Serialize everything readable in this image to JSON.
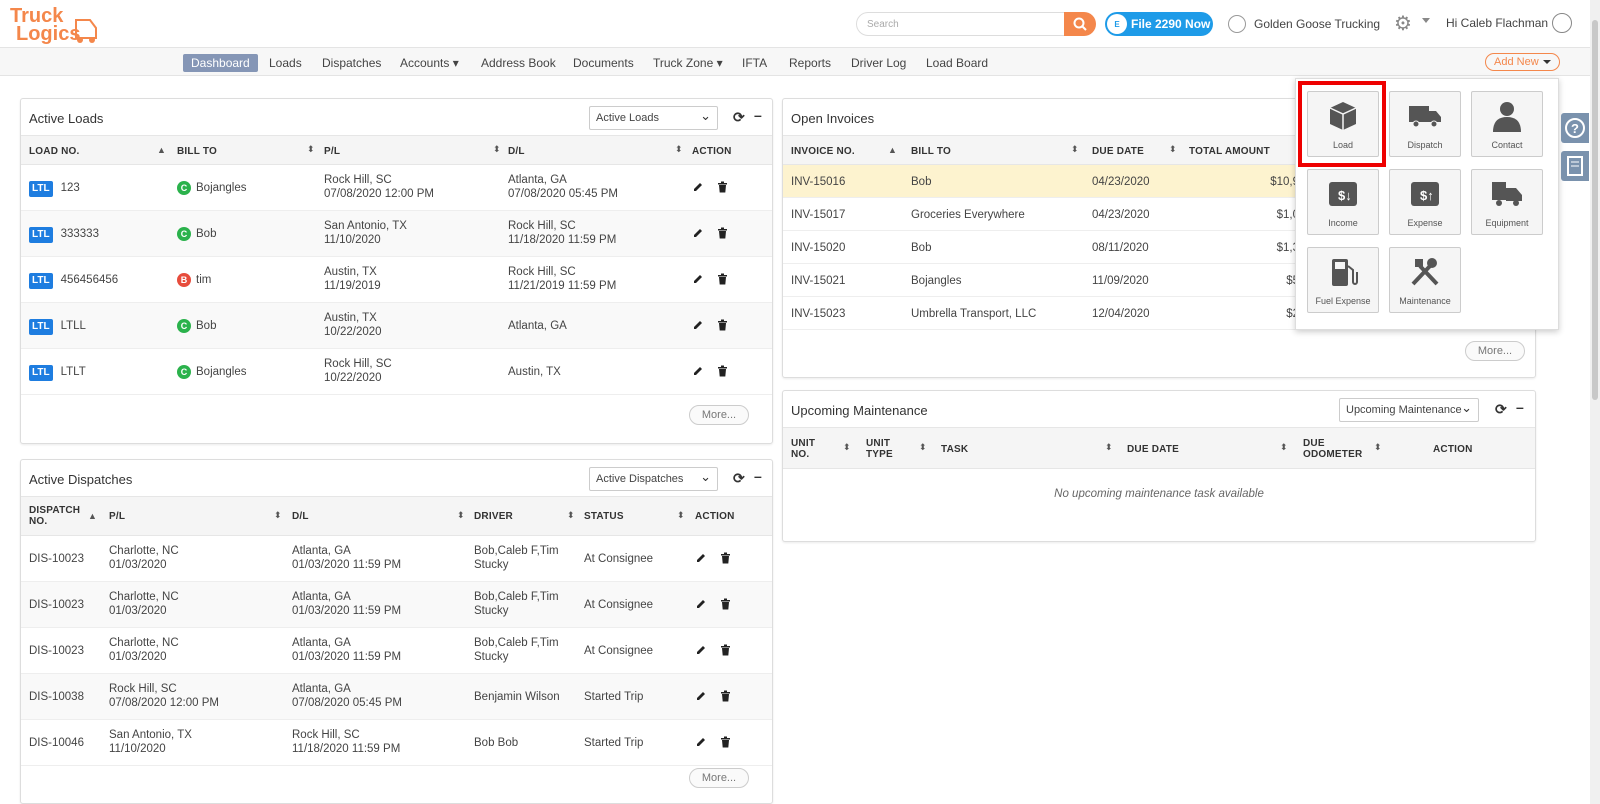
{
  "header": {
    "logo_text": "Truck Logics",
    "search_placeholder": "Search",
    "file_badge": "E",
    "file_label": "File 2290 Now",
    "company": "Golden Goose Trucking",
    "greeting": "Hi Caleb Flachman"
  },
  "nav": {
    "items": [
      "Dashboard",
      "Loads",
      "Dispatches",
      "Accounts ▾",
      "Address Book",
      "Documents",
      "Truck Zone ▾",
      "IFTA",
      "Reports",
      "Driver Log",
      "Load Board"
    ],
    "add_new": "Add New"
  },
  "active_loads": {
    "title": "Active Loads",
    "select": "Active Loads",
    "headers": [
      "LOAD NO.",
      "BILL TO",
      "P/L",
      "D/L",
      "ACTION"
    ],
    "rows": [
      {
        "type": "LTL",
        "no": "123",
        "badge": "C",
        "bill": "Bojangles",
        "pl1": "Rock Hill, SC",
        "pl2": "07/08/2020 12:00 PM",
        "dl1": "Atlanta, GA",
        "dl2": "07/08/2020 05:45 PM"
      },
      {
        "type": "LTL",
        "no": "333333",
        "badge": "C",
        "bill": "Bob",
        "pl1": "San Antonio, TX",
        "pl2": "11/10/2020",
        "dl1": "Rock Hill, SC",
        "dl2": "11/18/2020 11:59 PM"
      },
      {
        "type": "LTL",
        "no": "456456456",
        "badge": "B",
        "bill": "tim",
        "pl1": "Austin, TX",
        "pl2": "11/19/2019",
        "dl1": "Rock Hill, SC",
        "dl2": "11/21/2019 11:59 PM"
      },
      {
        "type": "LTL",
        "no": "LTLL",
        "badge": "C",
        "bill": "Bob",
        "pl1": "Austin, TX",
        "pl2": "10/22/2020",
        "dl1": "Atlanta, GA",
        "dl2": ""
      },
      {
        "type": "LTL",
        "no": "LTLT",
        "badge": "C",
        "bill": "Bojangles",
        "pl1": "Rock Hill, SC",
        "pl2": "10/22/2020",
        "dl1": "Austin, TX",
        "dl2": ""
      }
    ],
    "more": "More..."
  },
  "active_dispatches": {
    "title": "Active Dispatches",
    "select": "Active Dispatches",
    "headers": [
      "DISPATCH NO.",
      "P/L",
      "D/L",
      "DRIVER",
      "STATUS",
      "ACTION"
    ],
    "rows": [
      {
        "no": "DIS-10023",
        "pl1": "Charlotte, NC",
        "pl2": "01/03/2020",
        "dl1": "Atlanta, GA",
        "dl2": "01/03/2020 11:59 PM",
        "drv1": "Bob,Caleb F,Tim",
        "drv2": "Stucky",
        "status": "At Consignee"
      },
      {
        "no": "DIS-10023",
        "pl1": "Charlotte, NC",
        "pl2": "01/03/2020",
        "dl1": "Atlanta, GA",
        "dl2": "01/03/2020 11:59 PM",
        "drv1": "Bob,Caleb F,Tim",
        "drv2": "Stucky",
        "status": "At Consignee"
      },
      {
        "no": "DIS-10023",
        "pl1": "Charlotte, NC",
        "pl2": "01/03/2020",
        "dl1": "Atlanta, GA",
        "dl2": "01/03/2020 11:59 PM",
        "drv1": "Bob,Caleb F,Tim",
        "drv2": "Stucky",
        "status": "At Consignee"
      },
      {
        "no": "DIS-10038",
        "pl1": "Rock Hill, SC",
        "pl2": "07/08/2020 12:00 PM",
        "dl1": "Atlanta, GA",
        "dl2": "07/08/2020 05:45 PM",
        "drv1": "Benjamin Wilson",
        "drv2": "",
        "status": "Started Trip"
      },
      {
        "no": "DIS-10046",
        "pl1": "San Antonio, TX",
        "pl2": "11/10/2020",
        "dl1": "Rock Hill, SC",
        "dl2": "11/18/2020 11:59 PM",
        "drv1": "Bob Bob",
        "drv2": "",
        "status": "Started Trip"
      }
    ],
    "more": "More..."
  },
  "open_invoices": {
    "title": "Open Invoices",
    "headers": [
      "INVOICE NO.",
      "BILL TO",
      "DUE DATE",
      "TOTAL AMOUNT"
    ],
    "rows": [
      {
        "no": "INV-15016",
        "bill": "Bob",
        "due": "04/23/2020",
        "amt": "$10,9"
      },
      {
        "no": "INV-15017",
        "bill": "Groceries Everywhere",
        "due": "04/23/2020",
        "amt": "$1,0"
      },
      {
        "no": "INV-15020",
        "bill": "Bob",
        "due": "08/11/2020",
        "amt": "$1,3"
      },
      {
        "no": "INV-15021",
        "bill": "Bojangles",
        "due": "11/09/2020",
        "amt": "$5"
      },
      {
        "no": "INV-15023",
        "bill": "Umbrella Transport, LLC",
        "due": "12/04/2020",
        "amt": "$2"
      }
    ],
    "more": "More..."
  },
  "maintenance": {
    "title": "Upcoming Maintenance",
    "select": "Upcoming Maintenance",
    "headers": [
      "UNIT NO.",
      "UNIT TYPE",
      "TASK",
      "DUE DATE",
      "DUE ODOMETER",
      "ACTION"
    ],
    "empty": "No upcoming maintenance task available"
  },
  "add_menu": {
    "tiles": [
      {
        "label": "Load",
        "icon": "box-icon"
      },
      {
        "label": "Dispatch",
        "icon": "truck-icon"
      },
      {
        "label": "Contact",
        "icon": "person-icon"
      },
      {
        "label": "Income",
        "icon": "income-icon"
      },
      {
        "label": "Expense",
        "icon": "expense-icon"
      },
      {
        "label": "Equipment",
        "icon": "equipment-icon"
      },
      {
        "label": "Fuel Expense",
        "icon": "fuel-icon"
      },
      {
        "label": "Maintenance",
        "icon": "tools-icon"
      }
    ]
  },
  "colors": {
    "accent": "#f4874b",
    "nav_active": "#8596b6",
    "ltl": "#1e7de0",
    "badge_c": "#2bb24c",
    "badge_b": "#e74c3c",
    "highlight_row": "#fdf3cf",
    "tile_highlight": "#e00000"
  }
}
